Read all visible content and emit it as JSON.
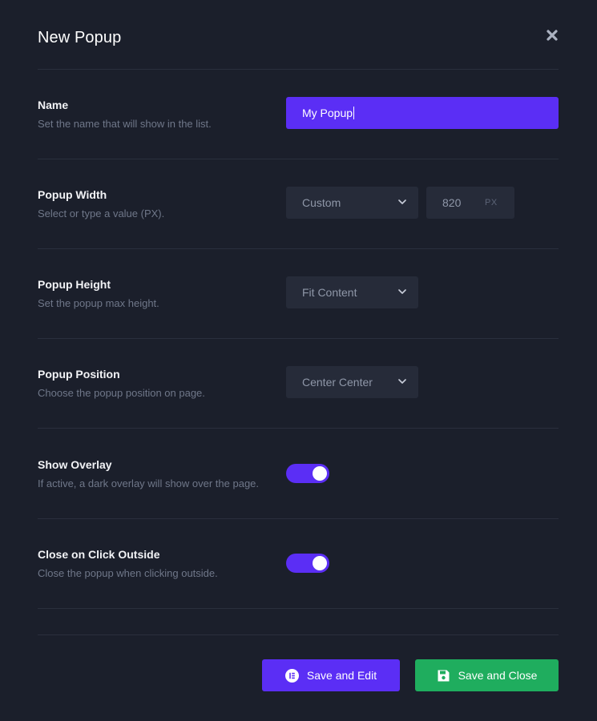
{
  "modal": {
    "title": "New Popup"
  },
  "name_row": {
    "label": "Name",
    "description": "Set the name that will show in the list.",
    "value": "My Popup"
  },
  "width_row": {
    "label": "Popup Width",
    "description": "Select or type a value (PX).",
    "select_value": "Custom",
    "number_value": "820",
    "unit": "PX"
  },
  "height_row": {
    "label": "Popup Height",
    "description": "Set the popup max height.",
    "select_value": "Fit Content"
  },
  "position_row": {
    "label": "Popup Position",
    "description": "Choose the popup position on page.",
    "select_value": "Center Center"
  },
  "overlay_row": {
    "label": "Show Overlay",
    "description": "If active, a dark overlay will show over the page.",
    "enabled": true
  },
  "click_outside_row": {
    "label": "Close on Click Outside",
    "description": "Close the popup when clicking outside.",
    "enabled": true
  },
  "footer": {
    "save_edit_label": "Save and Edit",
    "save_close_label": "Save and Close"
  },
  "colors": {
    "background": "#1b1f2b",
    "accent": "#5b2ef5",
    "success": "#1fad5e",
    "field": "#262b39"
  },
  "icons": {
    "close": "close-icon",
    "chevron": "chevron-down-icon",
    "elementor": "elementor-icon",
    "save": "floppy-disk-icon"
  }
}
